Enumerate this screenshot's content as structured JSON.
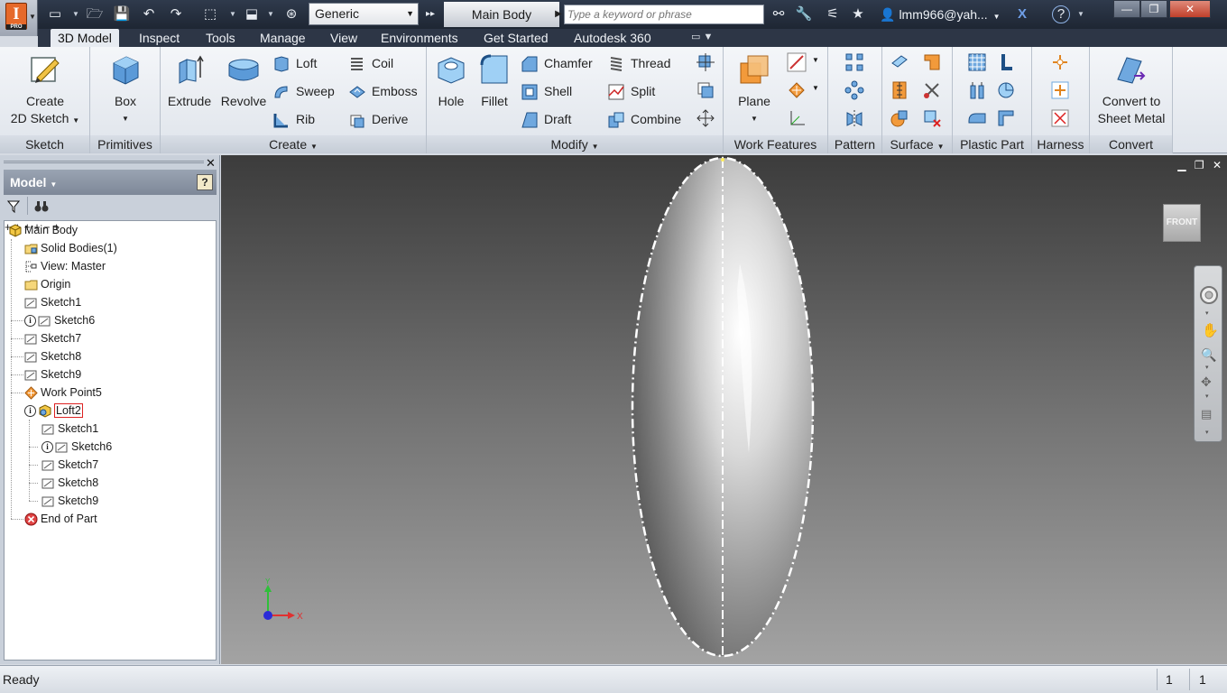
{
  "title_bar": {
    "material": "Generic",
    "document_title": "Main Body",
    "search_placeholder": "Type a keyword or phrase",
    "user": "lmm966@yah...",
    "help": "?"
  },
  "tabs": [
    {
      "label": "3D Model",
      "active": true
    },
    {
      "label": "Inspect"
    },
    {
      "label": "Tools"
    },
    {
      "label": "Manage"
    },
    {
      "label": "View"
    },
    {
      "label": "Environments"
    },
    {
      "label": "Get Started"
    },
    {
      "label": "Autodesk 360"
    }
  ],
  "ribbon": {
    "sketch": {
      "title": "Sketch",
      "create_2d_sketch_1": "Create",
      "create_2d_sketch_2": "2D Sketch"
    },
    "primitives": {
      "title": "Primitives",
      "box": "Box"
    },
    "create": {
      "title": "Create",
      "extrude": "Extrude",
      "revolve": "Revolve",
      "loft": "Loft",
      "sweep": "Sweep",
      "rib": "Rib",
      "coil": "Coil",
      "emboss": "Emboss",
      "derive": "Derive"
    },
    "modify": {
      "title": "Modify",
      "hole": "Hole",
      "fillet": "Fillet",
      "chamfer": "Chamfer",
      "shell": "Shell",
      "draft": "Draft",
      "thread": "Thread",
      "split": "Split",
      "combine": "Combine"
    },
    "work_features": {
      "title": "Work Features",
      "plane": "Plane"
    },
    "pattern": {
      "title": "Pattern"
    },
    "surface": {
      "title": "Surface"
    },
    "plastic_part": {
      "title": "Plastic Part"
    },
    "harness": {
      "title": "Harness"
    },
    "convert": {
      "title": "Convert",
      "convert_1": "Convert to",
      "convert_2": "Sheet Metal"
    }
  },
  "browser": {
    "header": "Model",
    "tree": [
      {
        "label": "Main Body"
      },
      {
        "label": "Solid Bodies(1)"
      },
      {
        "label": "View: Master"
      },
      {
        "label": "Origin"
      },
      {
        "label": "Sketch1"
      },
      {
        "label": "Sketch6"
      },
      {
        "label": "Sketch7"
      },
      {
        "label": "Sketch8"
      },
      {
        "label": "Sketch9"
      },
      {
        "label": "Work Point5"
      },
      {
        "label": "Loft2"
      },
      {
        "label": "Sketch1"
      },
      {
        "label": "Sketch6"
      },
      {
        "label": "Sketch7"
      },
      {
        "label": "Sketch8"
      },
      {
        "label": "Sketch9"
      },
      {
        "label": "End of Part"
      }
    ]
  },
  "viewport": {
    "viewcube_face": "FRONT",
    "axis_x": "X",
    "axis_y": "Y"
  },
  "status_bar": {
    "text": "Ready",
    "count_1": "1",
    "count_2": "1"
  }
}
